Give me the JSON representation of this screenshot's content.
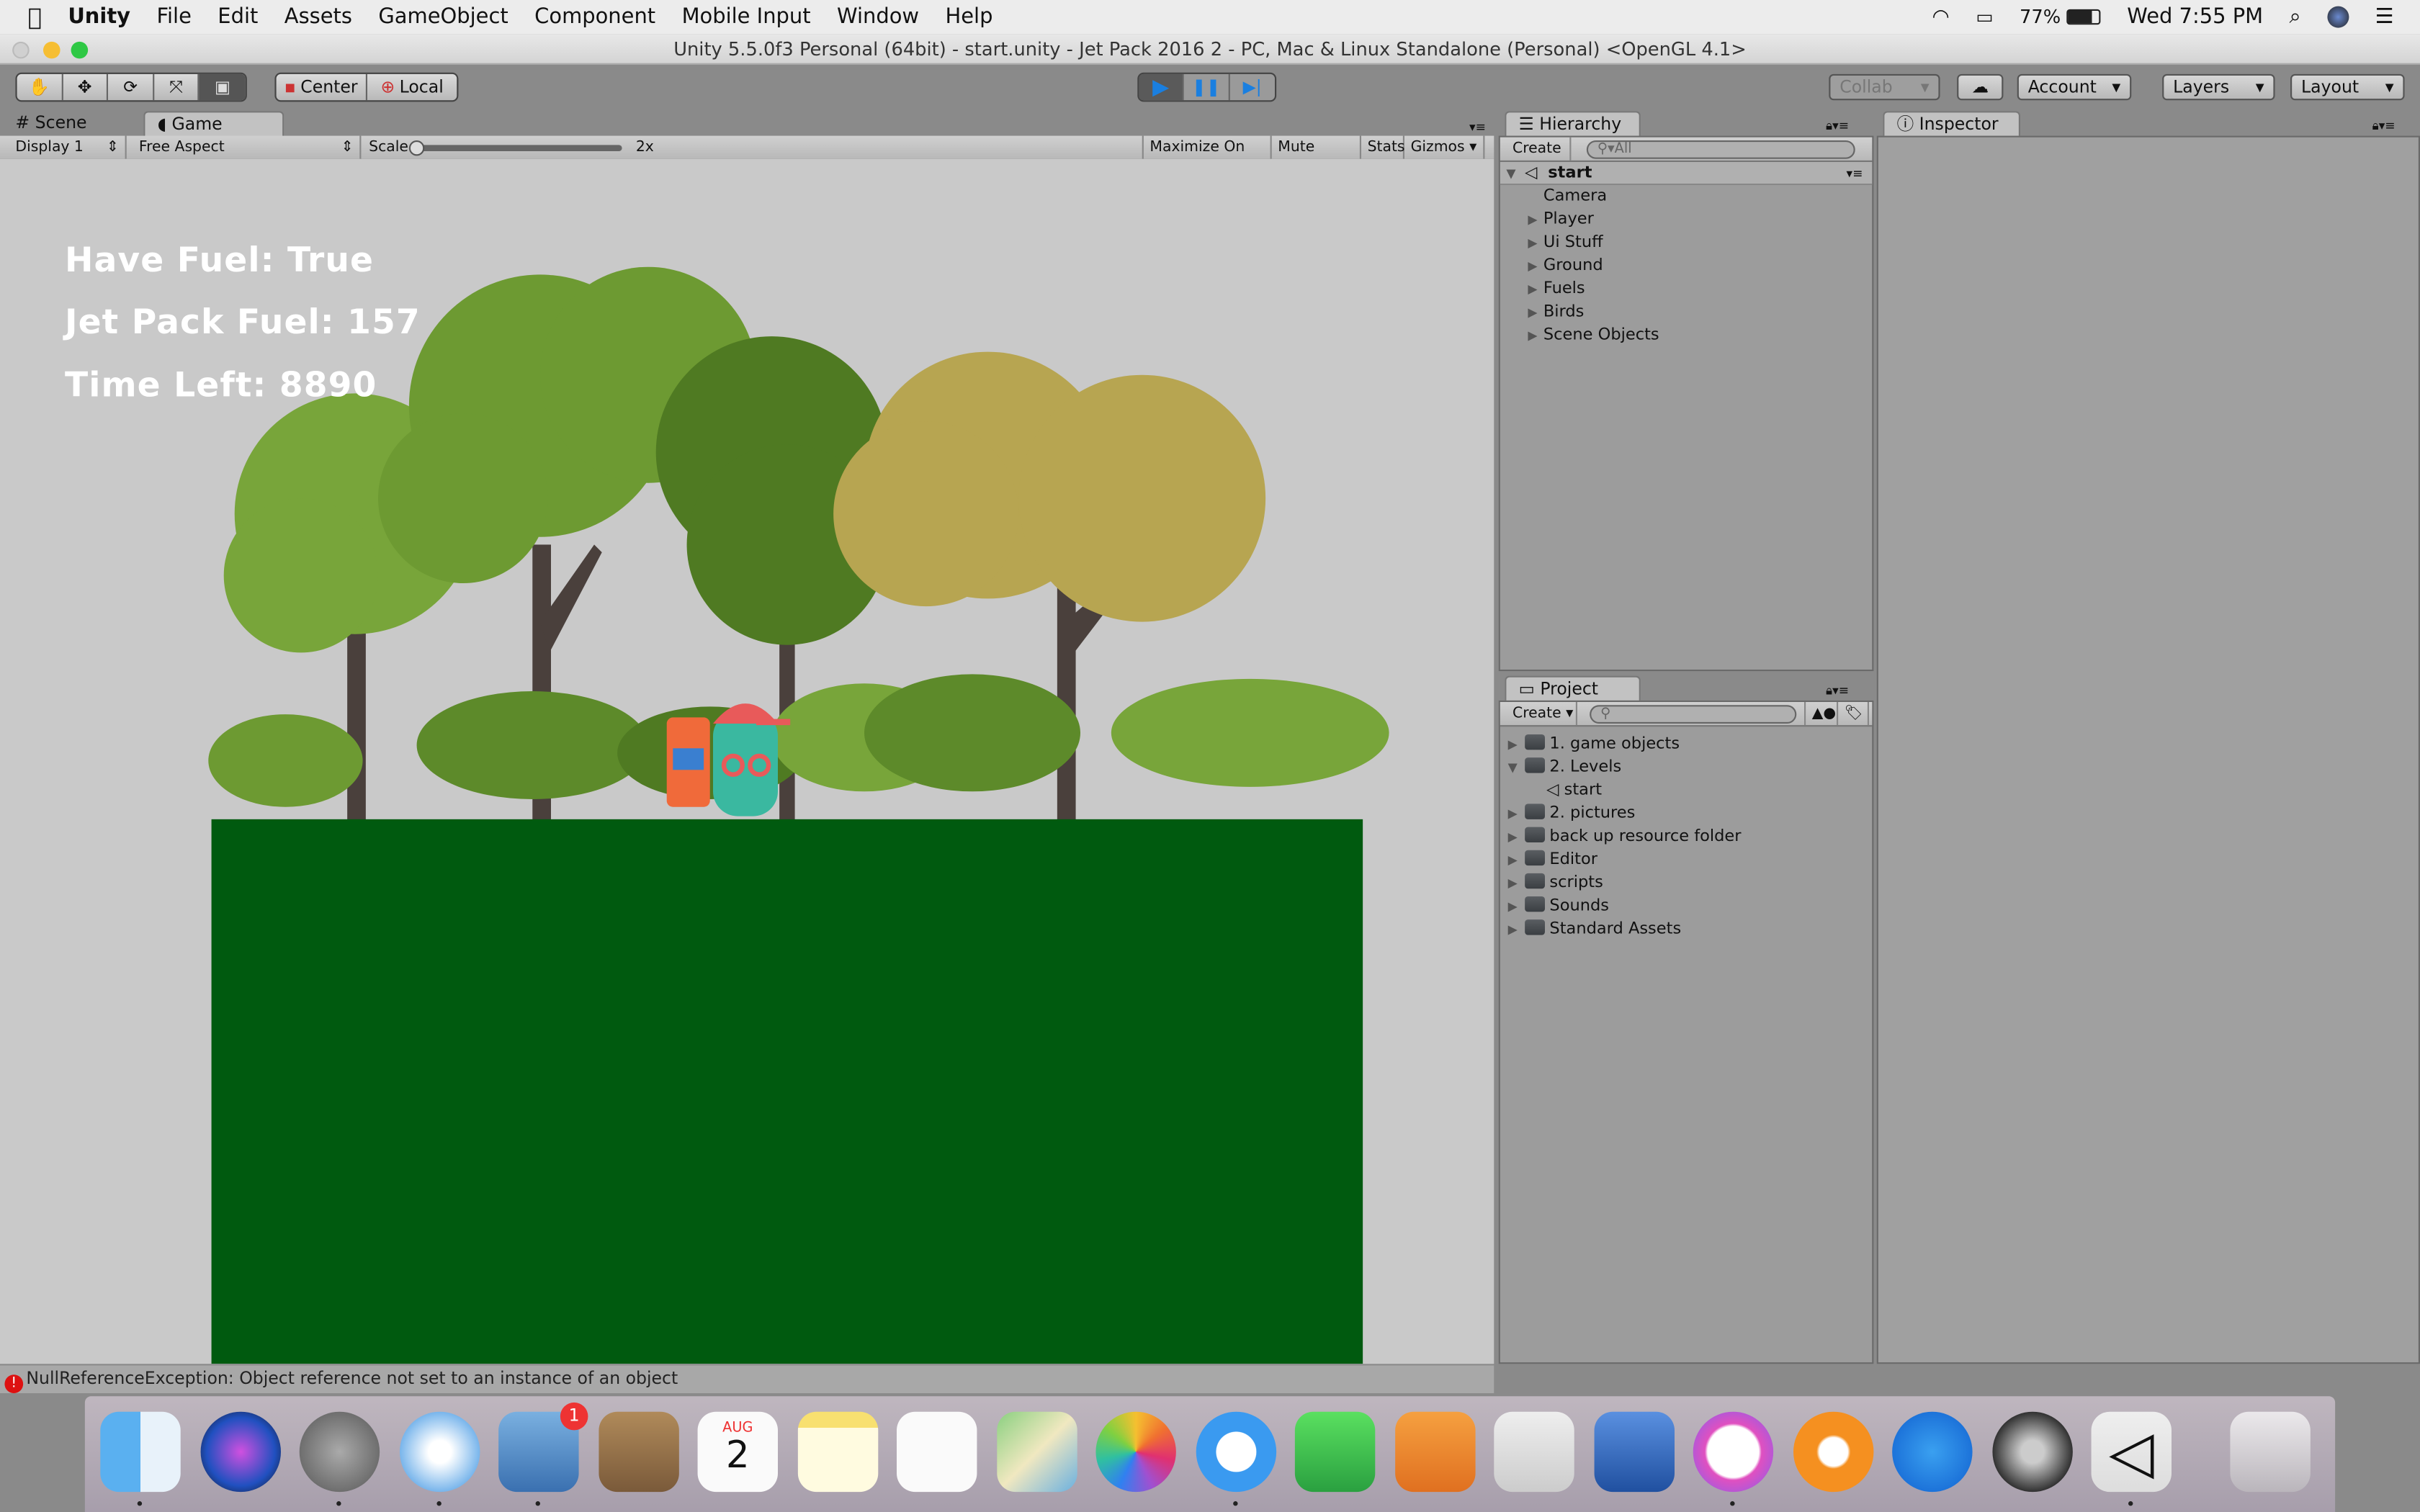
{
  "menubar": {
    "apple": "",
    "items": [
      "Unity",
      "File",
      "Edit",
      "Assets",
      "GameObject",
      "Component",
      "Mobile Input",
      "Window",
      "Help"
    ],
    "battery": "77%",
    "clock": "Wed 7:55 PM"
  },
  "window_title": "Unity 5.5.0f3 Personal (64bit) - start.unity - Jet Pack 2016 2 - PC, Mac & Linux Standalone (Personal) <OpenGL 4.1>",
  "toolbar": {
    "pivot": "Center",
    "space": "Local",
    "collab": "Collab",
    "account": "Account",
    "layers": "Layers",
    "layout": "Layout"
  },
  "game_panel": {
    "tabs": [
      "Scene",
      "Game"
    ],
    "display": "Display 1",
    "aspect": "Free Aspect",
    "scale_label": "Scale",
    "scale_value": "2x",
    "scale_fraction": 0.0,
    "buttons": [
      "Maximize On Play",
      "Mute Audio",
      "Stats",
      "Gizmos"
    ]
  },
  "game_hud": {
    "fuel": "Have Fuel:  True",
    "jetpack": "Jet Pack Fuel:  157",
    "time": "Time Left: 8890"
  },
  "hierarchy": {
    "tab": "Hierarchy",
    "create": "Create",
    "search_placeholder": "All",
    "scene": "start",
    "items": [
      {
        "label": "Camera",
        "expandable": false
      },
      {
        "label": "Player",
        "expandable": true
      },
      {
        "label": "Ui Stuff",
        "expandable": true
      },
      {
        "label": "Ground",
        "expandable": true
      },
      {
        "label": "Fuels",
        "expandable": true
      },
      {
        "label": "Birds",
        "expandable": true
      },
      {
        "label": "Scene Objects",
        "expandable": true
      }
    ]
  },
  "project": {
    "tab": "Project",
    "create": "Create",
    "items": [
      {
        "label": "1. game objects",
        "type": "folder",
        "expanded": false
      },
      {
        "label": "2. Levels",
        "type": "folder",
        "expanded": true
      },
      {
        "label": "start",
        "type": "scene",
        "expanded": false
      },
      {
        "label": "2. pictures",
        "type": "folder",
        "expanded": false
      },
      {
        "label": "back up resource folder",
        "type": "folder",
        "expanded": false
      },
      {
        "label": "Editor",
        "type": "folder",
        "expanded": false
      },
      {
        "label": "scripts",
        "type": "folder",
        "expanded": false
      },
      {
        "label": "Sounds",
        "type": "folder",
        "expanded": false
      },
      {
        "label": "Standard Assets",
        "type": "folder",
        "expanded": false
      }
    ]
  },
  "inspector": {
    "tab": "Inspector"
  },
  "status": {
    "message": "NullReferenceException: Object reference not set to an instance of an object"
  },
  "dock": {
    "mail_badge": "1",
    "calendar_month": "AUG",
    "calendar_day": "2",
    "apps": [
      "finder",
      "siri",
      "launchpad",
      "safari",
      "mail",
      "contacts",
      "calendar",
      "notes",
      "reminders",
      "maps",
      "photos",
      "messages",
      "facetime",
      "pages",
      "numbers",
      "keynote",
      "itunes",
      "ibooks",
      "app-store",
      "system-preferences",
      "unity",
      "trash"
    ]
  },
  "colors": {
    "ground": "#005a0f",
    "play_blue": "#1a7fe0",
    "game_bg": "#c9c9c9"
  }
}
